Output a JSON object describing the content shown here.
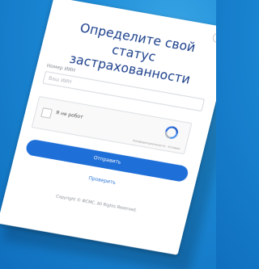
{
  "background_color": "#1c8ad6",
  "accent_color": "#1f6fd8",
  "modal": {
    "close_symbol": "×",
    "title": "Определите свой статус застрахованности",
    "field": {
      "label": "Номер ИИН",
      "placeholder": "Ваш ИИН"
    },
    "captcha": {
      "label": "Я не робот",
      "terms": "Конфиденциальность - Условия",
      "icon": "recaptcha-icon"
    },
    "submit_label": "Отправить",
    "link_label": "Проверить",
    "footer": "Copyright © ФСМС. All Rights Reserved."
  }
}
